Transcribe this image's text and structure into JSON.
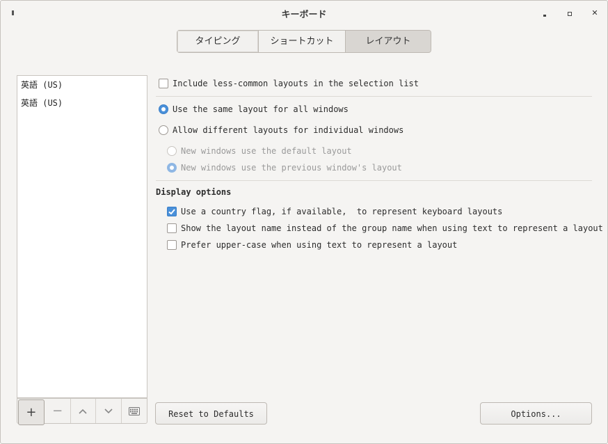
{
  "window": {
    "title": "キーボード"
  },
  "tabs": [
    {
      "label": "タイピング"
    },
    {
      "label": "ショートカット"
    },
    {
      "label": "レイアウト",
      "active": true
    }
  ],
  "layouts": [
    {
      "label": "英語 (US)"
    },
    {
      "label": "英語 (US)"
    }
  ],
  "list_toolbar": {
    "add": "+",
    "remove": "−"
  },
  "options": {
    "include_less_common": {
      "label": "Include less-common layouts in the selection list",
      "checked": false
    },
    "same_layout": {
      "label": "Use the same layout for all windows",
      "selected": true
    },
    "different_layouts": {
      "label": "Allow different layouts for individual windows",
      "selected": false
    },
    "new_default": {
      "label": "New windows use the default layout",
      "selected": false
    },
    "new_previous": {
      "label": "New windows use the previous window's layout",
      "selected": true
    }
  },
  "display_options": {
    "heading": "Display options",
    "country_flag": {
      "label": "Use a country flag, if available,  to represent keyboard layouts",
      "checked": true
    },
    "layout_name": {
      "label": "Show the layout name instead of the group name when using text to represent a layout",
      "checked": false
    },
    "upper_case": {
      "label": "Prefer upper-case when using text to represent a layout",
      "checked": false
    }
  },
  "buttons": {
    "reset": "Reset to Defaults",
    "options": "Options..."
  },
  "colors": {
    "accent": "#4a90d9",
    "background": "#f5f4f2"
  }
}
